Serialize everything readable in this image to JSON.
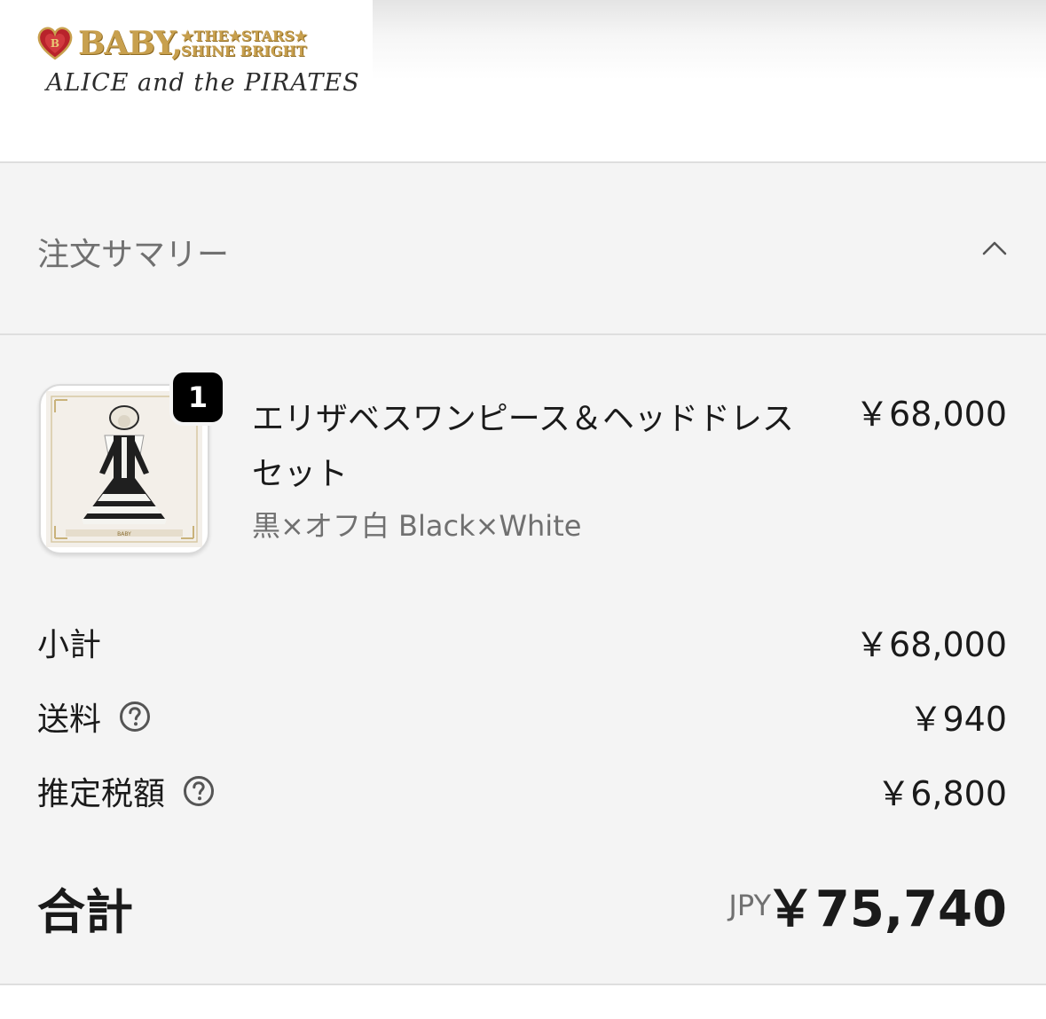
{
  "header": {
    "logo_brand": "BABY,",
    "logo_tagline_1": "★THE★STARS★",
    "logo_tagline_2": "SHINE BRIGHT",
    "logo_sub": "ALICE and the PIRATES",
    "brand_color": "#c8a04e"
  },
  "summary": {
    "title": "注文サマリー",
    "toggle_icon": "chevron-up-icon",
    "expanded": true
  },
  "item": {
    "quantity": "1",
    "name": "エリザベスワンピース＆ヘッドドレスセット",
    "variant": "黒×オフ白 Black×White",
    "price": "￥68,000",
    "thumbnail_icon": "dress-product-image"
  },
  "costs": {
    "subtotal_label": "小計",
    "subtotal_value": "￥68,000",
    "shipping_label": "送料",
    "shipping_value": "￥940",
    "tax_label": "推定税額",
    "tax_value": "￥6,800",
    "help_icon": "question-circle-icon"
  },
  "total": {
    "label": "合計",
    "currency": "JPY",
    "value": "￥75,740"
  }
}
